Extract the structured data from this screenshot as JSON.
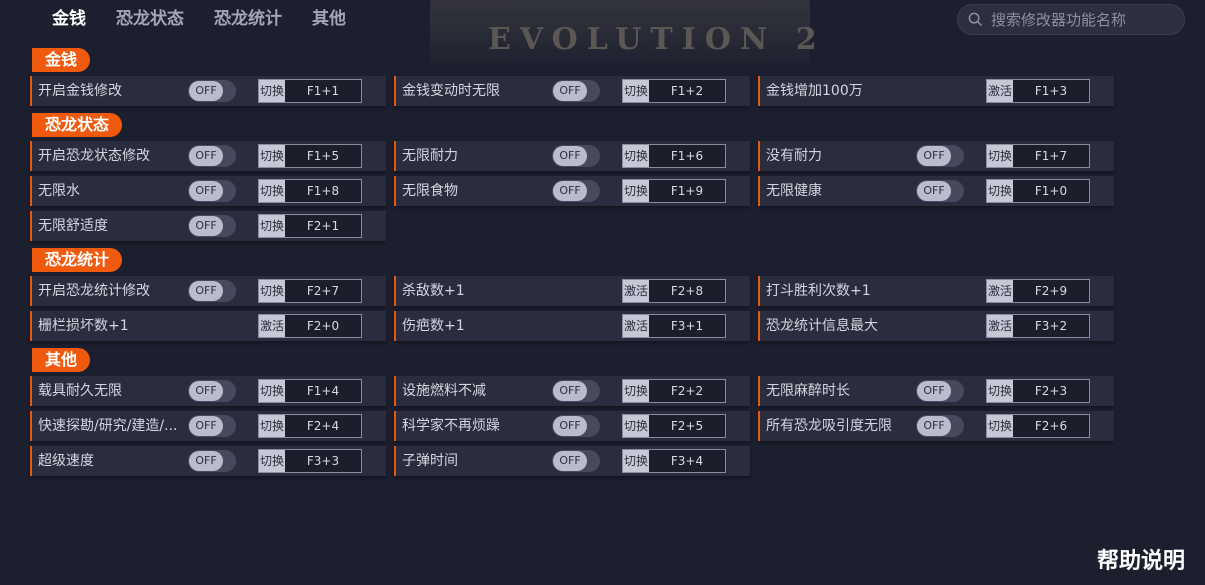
{
  "nav": {
    "tabs": [
      {
        "label": "金钱",
        "active": true
      },
      {
        "label": "恐龙状态",
        "active": false
      },
      {
        "label": "恐龙统计",
        "active": false
      },
      {
        "label": "其他",
        "active": false
      }
    ]
  },
  "background_title": "EVOLUTION 2",
  "search": {
    "placeholder": "搜索修改器功能名称"
  },
  "colors": {
    "accent": "#f05a0e",
    "background": "#1c1f2e",
    "row": "#2a2d3d"
  },
  "toggle_off_label": "OFF",
  "sections": [
    {
      "title": "金钱",
      "rows": [
        [
          {
            "label": "开启金钱修改",
            "toggle": true,
            "action": "切换",
            "key": "F1+1"
          },
          {
            "label": "金钱变动时无限",
            "toggle": true,
            "action": "切换",
            "key": "F1+2"
          },
          {
            "label": "金钱增加100万",
            "toggle": false,
            "action": "激活",
            "key": "F1+3"
          }
        ]
      ]
    },
    {
      "title": "恐龙状态",
      "rows": [
        [
          {
            "label": "开启恐龙状态修改",
            "toggle": true,
            "action": "切换",
            "key": "F1+5"
          },
          {
            "label": "无限耐力",
            "toggle": true,
            "action": "切换",
            "key": "F1+6"
          },
          {
            "label": "没有耐力",
            "toggle": true,
            "action": "切换",
            "key": "F1+7"
          }
        ],
        [
          {
            "label": "无限水",
            "toggle": true,
            "action": "切换",
            "key": "F1+8"
          },
          {
            "label": "无限食物",
            "toggle": true,
            "action": "切换",
            "key": "F1+9"
          },
          {
            "label": "无限健康",
            "toggle": true,
            "action": "切换",
            "key": "F1+0"
          }
        ],
        [
          {
            "label": "无限舒适度",
            "toggle": true,
            "action": "切换",
            "key": "F2+1"
          }
        ]
      ]
    },
    {
      "title": "恐龙统计",
      "rows": [
        [
          {
            "label": "开启恐龙统计修改",
            "toggle": true,
            "action": "切换",
            "key": "F2+7"
          },
          {
            "label": "杀敌数+1",
            "toggle": false,
            "action": "激活",
            "key": "F2+8"
          },
          {
            "label": "打斗胜利次数+1",
            "toggle": false,
            "action": "激活",
            "key": "F2+9"
          }
        ],
        [
          {
            "label": "栅栏损坏数+1",
            "toggle": false,
            "action": "激活",
            "key": "F2+0"
          },
          {
            "label": "伤疤数+1",
            "toggle": false,
            "action": "激活",
            "key": "F3+1"
          },
          {
            "label": "恐龙统计信息最大",
            "toggle": false,
            "action": "激活",
            "key": "F3+2"
          }
        ]
      ]
    },
    {
      "title": "其他",
      "rows": [
        [
          {
            "label": "载具耐久无限",
            "toggle": true,
            "action": "切换",
            "key": "F1+4"
          },
          {
            "label": "设施燃料不减",
            "toggle": true,
            "action": "切换",
            "key": "F2+2"
          },
          {
            "label": "无限麻醉时长",
            "toggle": true,
            "action": "切换",
            "key": "F2+3"
          }
        ],
        [
          {
            "label": "快速探勘/研究/建造/...",
            "toggle": true,
            "action": "切换",
            "key": "F2+4"
          },
          {
            "label": "科学家不再烦躁",
            "toggle": true,
            "action": "切换",
            "key": "F2+5"
          },
          {
            "label": "所有恐龙吸引度无限",
            "toggle": true,
            "action": "切换",
            "key": "F2+6"
          }
        ],
        [
          {
            "label": "超级速度",
            "toggle": true,
            "action": "切换",
            "key": "F3+3"
          },
          {
            "label": "子弹时间",
            "toggle": true,
            "action": "切换",
            "key": "F3+4"
          }
        ]
      ]
    }
  ],
  "help": {
    "label": "帮助说明"
  }
}
